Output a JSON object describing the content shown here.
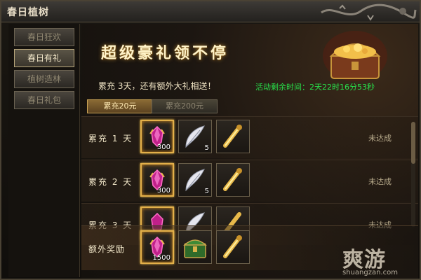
{
  "window": {
    "title": "春日植树"
  },
  "sidebar": {
    "tabs": [
      {
        "label": "春日狂欢",
        "active": false
      },
      {
        "label": "春日有礼",
        "active": true
      },
      {
        "label": "植树造林",
        "active": false
      },
      {
        "label": "春日礼包",
        "active": false
      }
    ]
  },
  "banner": {
    "title": "超级豪礼领不停",
    "subtitle": "累充 3天，还有额外大礼相送！",
    "timer": "活动剩余时间：2天22时16分53秒"
  },
  "tiers": [
    {
      "label": "累充20元",
      "active": true
    },
    {
      "label": "累充200元",
      "active": false
    }
  ],
  "rows": [
    {
      "label": "累充 1 天",
      "status": "未达成",
      "items": [
        {
          "icon": "purple-gem-icon",
          "qty": "300",
          "highlight": true
        },
        {
          "icon": "feather-icon",
          "qty": "5",
          "highlight": false
        },
        {
          "icon": "golden-scroll-icon",
          "qty": "",
          "highlight": false
        }
      ]
    },
    {
      "label": "累充 2 天",
      "status": "未达成",
      "items": [
        {
          "icon": "purple-gem-icon",
          "qty": "300",
          "highlight": true
        },
        {
          "icon": "feather-icon",
          "qty": "5",
          "highlight": false
        },
        {
          "icon": "golden-scroll-icon",
          "qty": "",
          "highlight": false
        }
      ]
    },
    {
      "label": "累充 3 天",
      "status": "未达成",
      "items": [
        {
          "icon": "purple-gem-icon",
          "qty": "",
          "highlight": true
        },
        {
          "icon": "feather-icon",
          "qty": "",
          "highlight": false
        },
        {
          "icon": "golden-scroll-icon",
          "qty": "",
          "highlight": false
        }
      ]
    }
  ],
  "bonus": {
    "label": "额外奖励",
    "items": [
      {
        "icon": "purple-gem-icon",
        "qty": "1500",
        "highlight": true
      },
      {
        "icon": "green-chest-icon",
        "qty": "",
        "highlight": false
      },
      {
        "icon": "golden-scroll-icon",
        "qty": "",
        "highlight": false
      }
    ]
  },
  "watermark": {
    "logo": "爽游",
    "url": "shuangzan.com"
  },
  "colors": {
    "timer": "#28e04a",
    "gold_border": "#e3b04a",
    "title_glow": "#a87a2a"
  }
}
